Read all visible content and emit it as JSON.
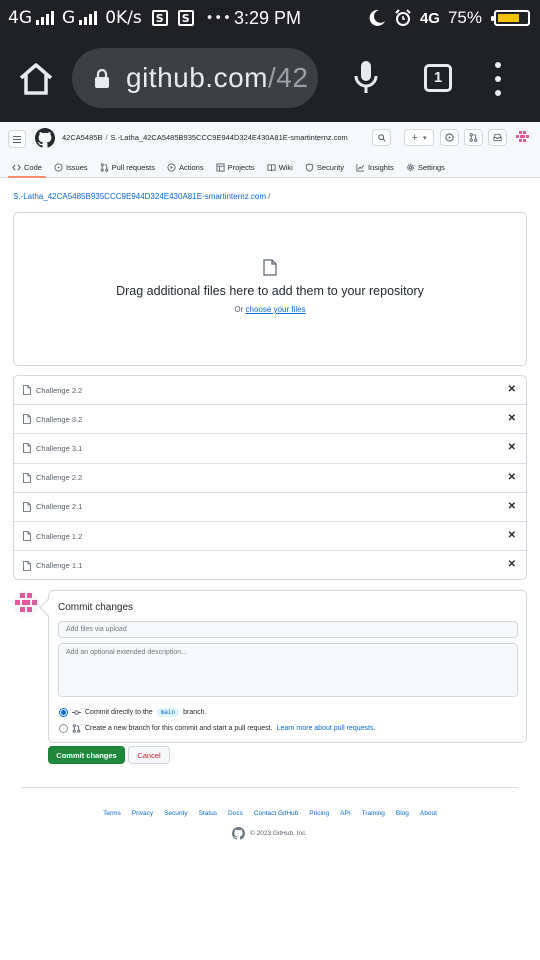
{
  "status_bar": {
    "network_left": "4G",
    "network_mid": "G",
    "speed": "0K/s",
    "sq_icon_1": "S",
    "sq_icon_2": "S",
    "more": "•••",
    "time": "3:29 PM",
    "network_right": "4G",
    "battery_percent": "75%",
    "battery_level": 0.75
  },
  "browser": {
    "url_host": "github.com",
    "url_rest": "/42",
    "tab_count": "1"
  },
  "header": {
    "owner": "42CA5485B",
    "separator": "/",
    "repo": "S.-Latha_42CA5485B935CCC9E944D324E430A81E-smartinternz.com",
    "new_menu_plus": "+",
    "new_menu_caret": "▾"
  },
  "repo_nav": [
    {
      "label": "Code",
      "icon": "code-icon"
    },
    {
      "label": "Issues",
      "icon": "issue-icon"
    },
    {
      "label": "Pull requests",
      "icon": "pull-request-icon"
    },
    {
      "label": "Actions",
      "icon": "play-icon"
    },
    {
      "label": "Projects",
      "icon": "table-icon"
    },
    {
      "label": "Wiki",
      "icon": "book-icon"
    },
    {
      "label": "Security",
      "icon": "shield-icon"
    },
    {
      "label": "Insights",
      "icon": "graph-icon"
    },
    {
      "label": "Settings",
      "icon": "gear-icon"
    }
  ],
  "upload": {
    "path_repo": "S.-Latha_42CA5485B935CCC9E944D324E430A81E-smartinternz.com",
    "path_slash": "/",
    "drop_title": "Drag additional files here to add them to your repository",
    "drop_or": "Or",
    "choose_files": "choose your files",
    "files": [
      "Challenge 2.2",
      "Challenge 3.2",
      "Challenge 3.1",
      "Challenge 2.2",
      "Challenge 2.1",
      "Challenge 1.2",
      "Challenge 1.1"
    ],
    "remove_glyph": "✕"
  },
  "commit": {
    "title": "Commit changes",
    "summary_placeholder": "Add files via upload",
    "description_placeholder": "Add an optional extended description...",
    "option_direct_before": "Commit directly to the",
    "branch": "main",
    "option_direct_after": "branch.",
    "option_new_branch": "Create a new branch for this commit and start a pull request.",
    "learn_more": "Learn more about pull requests.",
    "commit_button": "Commit changes",
    "cancel_button": "Cancel"
  },
  "footer": {
    "links": [
      "Terms",
      "Privacy",
      "Security",
      "Status",
      "Docs",
      "Contact GitHub",
      "Pricing",
      "API",
      "Training",
      "Blog",
      "About"
    ],
    "copyright": "© 2023 GitHub, Inc."
  },
  "colors": {
    "chrome_bg": "#202124",
    "omnibox_bg": "#3c4043",
    "link_blue": "#0969da",
    "primary_green": "#1f883d",
    "danger_red": "#cf222e",
    "tab_underline": "#fd8c73",
    "battery_fill": "#f3c300"
  }
}
